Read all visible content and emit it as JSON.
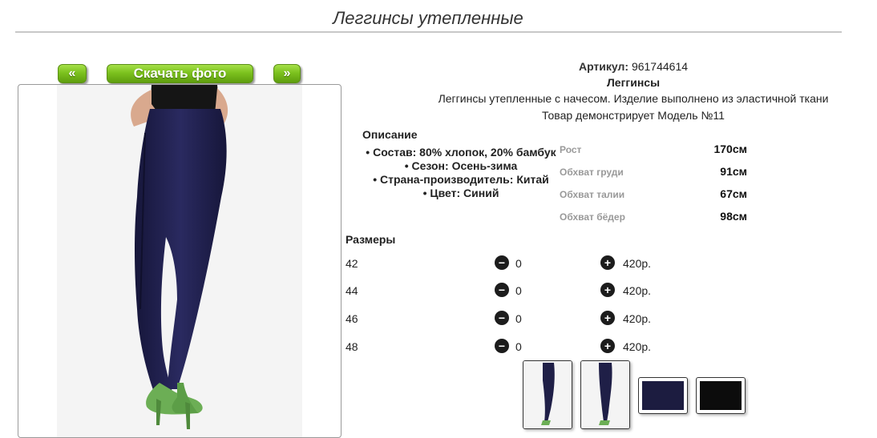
{
  "page": {
    "title": "Леггинсы утепленные"
  },
  "photo_nav": {
    "prev_label": "«",
    "download_label": "Скачать фото",
    "next_label": "»"
  },
  "product": {
    "article_label": "Артикул:",
    "article_value": "961744614",
    "category": "Леггинсы",
    "short_description": "Леггинсы утепленные с начесом. Изделие выполнено из эластичной ткани",
    "model_text": "Товар демонстрирует Модель №11"
  },
  "description": {
    "heading": "Описание",
    "items": [
      "Состав: 80% хлопок, 20% бамбук",
      "Сезон: Осень-зима",
      "Страна-производитель: Китай",
      "Цвет: Синий"
    ]
  },
  "measurements": [
    {
      "label": "Рост",
      "value": "170см"
    },
    {
      "label": "Обхват груди",
      "value": "91см"
    },
    {
      "label": "Обхват талии",
      "value": "67см"
    },
    {
      "label": "Обхват бёдер",
      "value": "98см"
    }
  ],
  "sizes": {
    "heading": "Размеры",
    "minus_icon": "minus-circle-icon",
    "plus_icon": "plus-circle-icon",
    "rows": [
      {
        "size": "42",
        "qty": "0",
        "price": "420р."
      },
      {
        "size": "44",
        "qty": "0",
        "price": "420р."
      },
      {
        "size": "46",
        "qty": "0",
        "price": "420р."
      },
      {
        "size": "48",
        "qty": "0",
        "price": "420р."
      }
    ]
  },
  "colors": {
    "accent_green": "#7cc21e",
    "fabric_navy": "#1f1f47",
    "shoe_green": "#6cae55",
    "text": "#222222"
  }
}
